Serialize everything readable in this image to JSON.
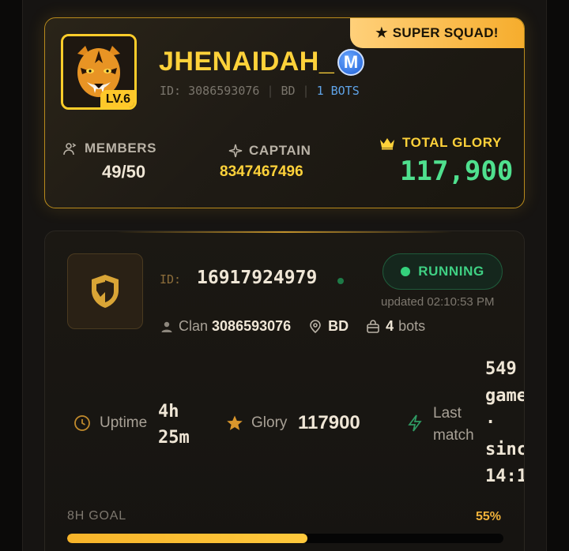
{
  "squad": {
    "ribbon": "SUPER SQUAD!",
    "level": "LV.6",
    "name": "JHENAIDAH_",
    "badge_letter": "M",
    "id_label": "ID:",
    "id": "3086593076",
    "region": "BD",
    "bots": "1 BOTS",
    "members_label": "MEMBERS",
    "members_value": "49/50",
    "captain_label": "CAPTAIN",
    "captain_value": "8347467496",
    "glory_label": "TOTAL GLORY",
    "glory_value": "117,900"
  },
  "bot": {
    "id_label": "ID:",
    "id": "16917924979",
    "status": "RUNNING",
    "updated": "updated 02:10:53 PM",
    "clan_label": "Clan",
    "clan_value": "3086593076",
    "region": "BD",
    "bots_count": "4",
    "bots_label": "bots",
    "uptime_label": "Uptime",
    "uptime_line1": "4h",
    "uptime_line2": "25m",
    "glory_label": "Glory",
    "glory_value": "117900",
    "last_match_line1": "Last",
    "last_match_line2": "match",
    "last_match_v1": "549",
    "last_match_v2": "game",
    "last_match_v3": "·",
    "last_match_v4": "sinc",
    "last_match_v5": "14:1",
    "goal_label": "8H GOAL",
    "goal_percent_text": "55%",
    "goal_progress": 0.55
  },
  "colors": {
    "gold": "#ffd23a",
    "green": "#3fd083",
    "blue": "#5fa3e8",
    "orange": "#f0b23a"
  },
  "icons": [
    "star-icon",
    "tiger-avatar",
    "verified-m-icon",
    "members-icon",
    "sparkle-icon",
    "crown-icon",
    "shield-icon",
    "user-icon",
    "location-pin-icon",
    "bag-icon",
    "clock-icon",
    "star-icon",
    "bolt-icon"
  ]
}
